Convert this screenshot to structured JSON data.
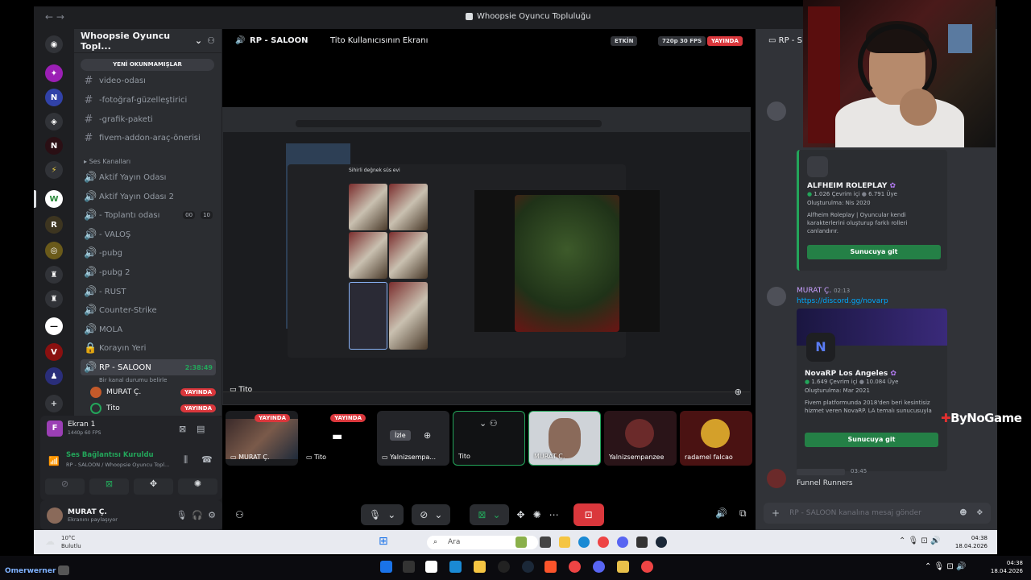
{
  "window": {
    "title": "Whoopsie Oyuncu Topluluğu"
  },
  "server": {
    "name": "Whoopsie Oyuncu Topl...",
    "unread_banner": "YENİ OKUNMAMIŞLAR"
  },
  "channels": {
    "text": [
      "video-odası",
      "-fotoğraf-güzelleştirici",
      "-grafik-paketi",
      "fivem-addon-araç-önerisi"
    ],
    "category": "Ses Kanalları",
    "voice": [
      "Aktif Yayın Odası",
      "Aktif Yayın Odası 2",
      "- Toplantı odası",
      "- VALOŞ",
      "-pubg",
      "-pubg 2",
      "- RUST",
      "Counter-Strike",
      "MOLA",
      "Korayın Yeri",
      "RP - SALOON"
    ],
    "meeting_counts": [
      "00",
      "10"
    ],
    "active_time": "2:38:49",
    "active_status": "Bir kanal durumu belirle",
    "members": [
      {
        "name": "MURAT Ç.",
        "badge": "YAYINDA"
      },
      {
        "name": "Tito",
        "badge": "YAYINDA"
      }
    ]
  },
  "voice_panel": {
    "screen_name": "Ekran 1",
    "screen_quality": "1440p 60 FPS",
    "connected": "Ses Bağlantısı Kuruldu",
    "location": "RP - SALOON / Whoopsie Oyuncu Topl..."
  },
  "user": {
    "name": "MURAT Ç.",
    "status": "Ekranını paylaşıyor"
  },
  "stage": {
    "channel": "RP - SALOON",
    "screen_title": "Tito Kullanıcısının Ekranı",
    "event_tag": "ETKİN",
    "quality_tag": "720p 30 FPS",
    "live_tag": "YAYINDA",
    "stream_owner": "Tito",
    "lightbox_title": "Sihirli değnek süs evi"
  },
  "tiles": [
    {
      "label": "MURAT Ç.",
      "badge": "YAYINDA"
    },
    {
      "label": "Tito",
      "badge": "YAYINDA"
    },
    {
      "label": "Yalnizsempa...",
      "watch": "İzle"
    },
    {
      "label": "Tito"
    },
    {
      "label": "MURAT Ç."
    },
    {
      "label": "Yalnizsempanzee"
    },
    {
      "label": "radamel falcao"
    }
  ],
  "chat": {
    "header": "RP - S",
    "embed1": {
      "name": "ALFHEIM ROLEPLAY",
      "online": "1.026 Çevrim içi",
      "members": "6.791 Üye",
      "created": "Oluşturulma: Nis 2020",
      "desc": "Alfheim Roleplay | Oyuncular kendi karakterlerini oluşturup farklı rolleri canlandırır.",
      "button": "Sunucuya git"
    },
    "msg2": {
      "author": "MURAT Ç.",
      "time": "02:13",
      "link": "https://discord.gg/novarp"
    },
    "embed2": {
      "name": "NovaRP Los Angeles",
      "online": "1.649 Çevrim içi",
      "members": "10.084 Üye",
      "created": "Oluşturulma: Mar 2021",
      "desc": "Fivem platformunda 2018'den beri kesintisiz hizmet veren NovaRP. LA temalı sunucusuyla",
      "button": "Sunucuya git"
    },
    "msg3": {
      "time": "03:45",
      "text": "Funnel Runners"
    },
    "input_placeholder": "RP - SALOON kanalına mesaj gönder"
  },
  "taskbar": {
    "weather_temp": "10°C",
    "weather_desc": "Bulutlu",
    "search": "Ara",
    "time": "04:38",
    "date": "18.04.2026"
  },
  "bottom_bar": {
    "user": "Omerwerner :",
    "time": "04:38",
    "date": "18.04.2026"
  },
  "watermark": "ByNoGame",
  "colors": {
    "accent": "#5865f2",
    "live": "#da373c",
    "green": "#23a55a",
    "link": "#00a8fc"
  }
}
